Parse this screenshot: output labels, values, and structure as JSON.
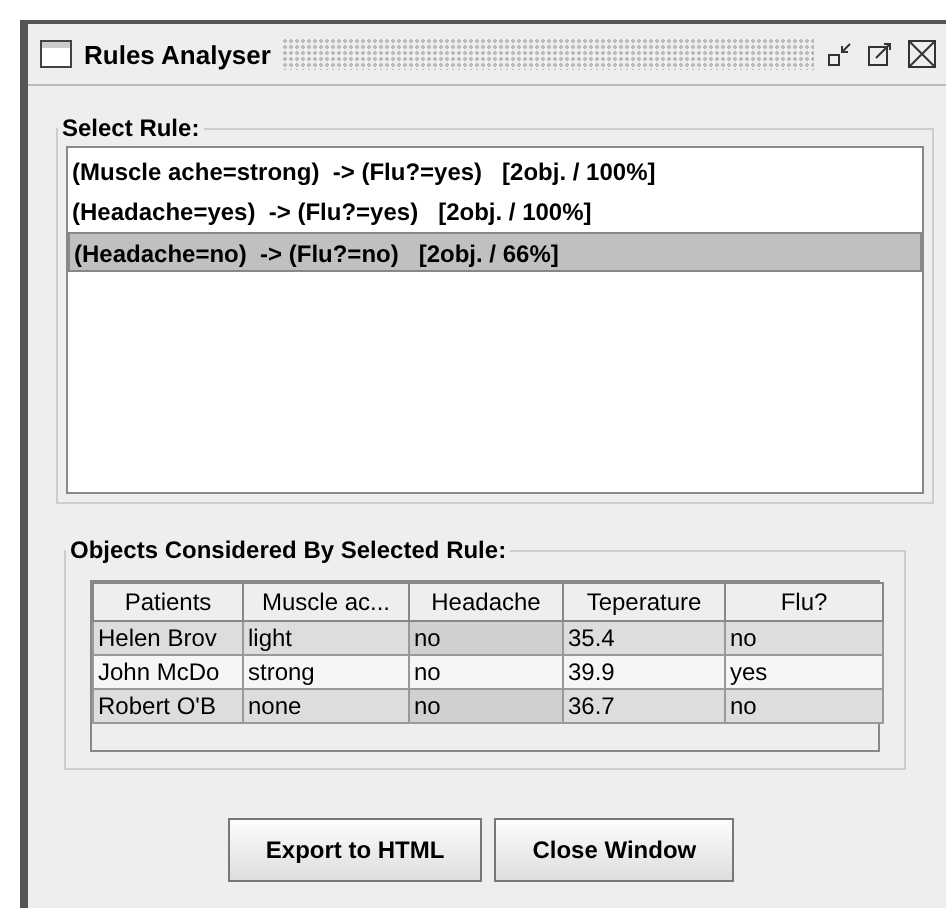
{
  "window": {
    "title": "Rules Analyser"
  },
  "rules_group": {
    "label": "Select Rule:",
    "rules": [
      {
        "text": "(Muscle ache=strong)  -> (Flu?=yes)   [2obj. / 100%]",
        "selected": false
      },
      {
        "text": "(Headache=yes)  -> (Flu?=yes)   [2obj. / 100%]",
        "selected": false
      },
      {
        "text": "(Headache=no)  -> (Flu?=no)   [2obj. / 66%]",
        "selected": true
      }
    ]
  },
  "objects_group": {
    "label": "Objects Considered By Selected Rule:",
    "table": {
      "columns": [
        "Patients",
        "Muscle ac...",
        "Headache",
        "Teperature",
        "Flu?"
      ],
      "rows": [
        [
          "Helen Brov",
          "light",
          "no",
          "35.4",
          "no"
        ],
        [
          "John McDo",
          "strong",
          "no",
          "39.9",
          "yes"
        ],
        [
          "Robert O'B",
          "none",
          "no",
          "36.7",
          "no"
        ]
      ]
    }
  },
  "buttons": [
    "Export to HTML",
    "Close Window"
  ]
}
